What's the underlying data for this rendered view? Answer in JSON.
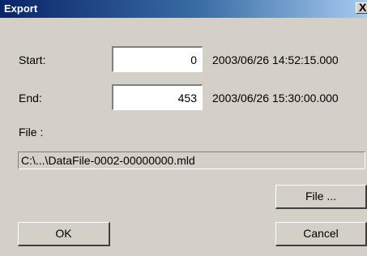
{
  "window": {
    "title": "Export",
    "close_glyph": "X"
  },
  "start": {
    "label": "Start:",
    "value": "0",
    "timestamp": "2003/06/26 14:52:15.000"
  },
  "end": {
    "label": "End:",
    "value": "453",
    "timestamp": "2003/06/26 15:30:00.000"
  },
  "file": {
    "label": "File :",
    "path": "C:\\...\\DataFile-0002-00000000.mld",
    "browse_label": "File ..."
  },
  "buttons": {
    "ok_label": "OK",
    "cancel_label": "Cancel"
  },
  "icons": {
    "close": "close-icon"
  },
  "colors": {
    "titlebar_start": "#0a246a",
    "titlebar_end": "#a6caf0",
    "dialog_face": "#d4d0c8"
  }
}
